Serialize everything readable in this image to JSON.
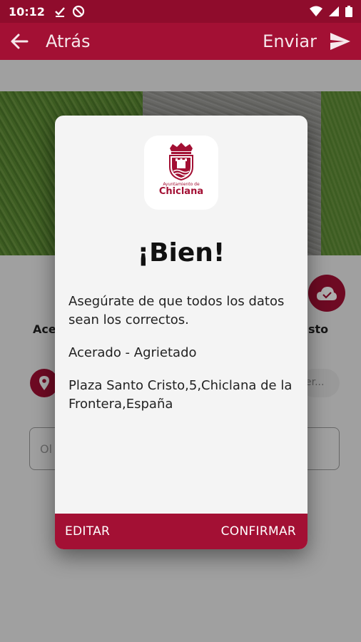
{
  "status_bar": {
    "time": "10:12"
  },
  "app_bar": {
    "back_label": "Atrás",
    "send_label": "Enviar"
  },
  "form": {
    "left_label": "Ace",
    "right_label": "sto",
    "address_placeholder": "er...",
    "observations_placeholder": "Ol"
  },
  "dialog": {
    "logo": {
      "line1": "Ayuntamiento de",
      "line2": "Chiclana"
    },
    "title": "¡Bien!",
    "message": "Asegúrate de que todos los datos sean los correctos.",
    "category": "Acerado - Agrietado",
    "address": "Plaza Santo Cristo,5,Chiclana de la Frontera,España",
    "edit_label": "EDITAR",
    "confirm_label": "CONFIRMAR"
  },
  "colors": {
    "primary": "#a31034",
    "status_bar": "#8f0c2c",
    "dialog_bg": "#f4f4f4"
  }
}
